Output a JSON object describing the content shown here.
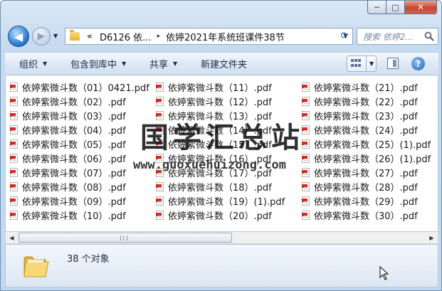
{
  "window": {
    "caption_min": "─",
    "caption_max": "□",
    "caption_close": "✕"
  },
  "nav": {
    "back_glyph": "◀",
    "forward_glyph": "▶",
    "history_glyph": "▼",
    "address_overflow": "«",
    "address_parent": "D6126 依...",
    "address_sep": "▸",
    "address_current": "依婷2021年系统班课件38节",
    "address_drop": "▼",
    "refresh_glyph": "⟳",
    "search_placeholder": "搜索 依婷2..."
  },
  "toolbar": {
    "organize": "组织",
    "include_library": "包含到库中",
    "share": "共享",
    "new_folder": "新建文件夹",
    "arrow": "▼",
    "help": "?"
  },
  "files": [
    [
      "依婷紫微斗数（01）0421.pdf",
      "依婷紫微斗数（11）.pdf",
      "依婷紫微斗数（21）.pdf"
    ],
    [
      "依婷紫微斗数（02）.pdf",
      "依婷紫微斗数（12）.pdf",
      "依婷紫微斗数（22）.pdf"
    ],
    [
      "依婷紫微斗数（03）.pdf",
      "依婷紫微斗数（13）.pdf",
      "依婷紫微斗数（23）.pdf"
    ],
    [
      "依婷紫微斗数（04）.pdf",
      "依婷紫微斗数（14）.pdf",
      "依婷紫微斗数（24）.pdf"
    ],
    [
      "依婷紫微斗数（05）.pdf",
      "依婷紫微斗数（15）.pdf",
      "依婷紫微斗数（25）(1).pdf"
    ],
    [
      "依婷紫微斗数（06）.pdf",
      "依婷紫微斗数（16）.pdf",
      "依婷紫微斗数（26）(1).pdf"
    ],
    [
      "依婷紫微斗数（07）.pdf",
      "依婷紫微斗数（17）.pdf",
      "依婷紫微斗数（27）.pdf"
    ],
    [
      "依婷紫微斗数（08）.pdf",
      "依婷紫微斗数（18）.pdf",
      "依婷紫微斗数（28）.pdf"
    ],
    [
      "依婷紫微斗数（09）.pdf",
      "依婷紫微斗数（19）(1).pdf",
      "依婷紫微斗数（29）.pdf"
    ],
    [
      "依婷紫微斗数（10）.pdf",
      "依婷紫微斗数（20）.pdf",
      "依婷紫微斗数（30）.pdf"
    ]
  ],
  "watermark": {
    "title": "国学汇总站",
    "url": "www.guoxuehuizong.com"
  },
  "scrollbar": {
    "left_glyph": "◀",
    "right_glyph": "▶"
  },
  "status": {
    "count": "38 个对象"
  },
  "colors": {
    "frame": "#c7dbf0",
    "close_button": "#c8452f",
    "pdf_red": "#d22b22",
    "folder_yellow": "#e4b43a"
  }
}
